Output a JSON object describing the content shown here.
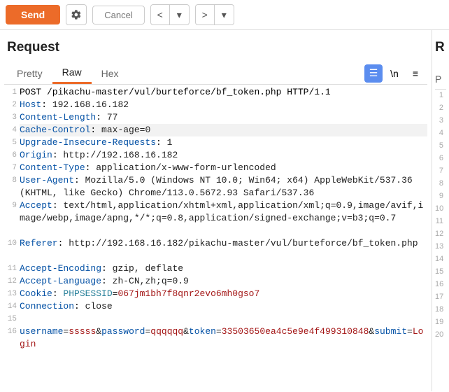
{
  "toolbar": {
    "send": "Send",
    "cancel": "Cancel"
  },
  "request": {
    "title": "Request",
    "tabs": {
      "pretty": "Pretty",
      "raw": "Raw",
      "hex": "Hex"
    },
    "symbols": {
      "newline": "\\n",
      "menu": "≡"
    },
    "raw": {
      "request_line": "POST /pikachu-master/vul/burteforce/bf_token.php HTTP/1.1",
      "headers": [
        {
          "k": "Host",
          "v": " 192.168.16.182"
        },
        {
          "k": "Content-Length",
          "v": " 77"
        },
        {
          "k": "Cache-Control",
          "v": " max-age=0"
        },
        {
          "k": "Upgrade-Insecure-Requests",
          "v": " 1"
        },
        {
          "k": "Origin",
          "v": " http://192.168.16.182"
        },
        {
          "k": "Content-Type",
          "v": " application/x-www-form-urlencoded"
        },
        {
          "k": "User-Agent",
          "v": " Mozilla/5.0 (Windows NT 10.0; Win64; x64) AppleWebKit/537.36 (KHTML, like Gecko) Chrome/113.0.5672.93 Safari/537.36"
        },
        {
          "k": "Accept",
          "v": " text/html,application/xhtml+xml,application/xml;q=0.9,image/avif,image/webp,image/apng,*/*;q=0.8,application/signed-exchange;v=b3;q=0.7"
        },
        {
          "k": "Referer",
          "v": " http://192.168.16.182/pikachu-master/vul/burteforce/bf_token.php"
        },
        {
          "k": "Accept-Encoding",
          "v": " gzip, deflate"
        },
        {
          "k": "Accept-Language",
          "v": " zh-CN,zh;q=0.9"
        }
      ],
      "cookie": {
        "k": "Cookie",
        "name": "PHPSESSID",
        "value": "067jm1bh7f8qnr2evo6mh0gso7"
      },
      "connection": {
        "k": "Connection",
        "v": " close"
      },
      "body": {
        "pairs": [
          {
            "k": "username",
            "v": "sssss"
          },
          {
            "k": "password",
            "v": "qqqqqq"
          },
          {
            "k": "token",
            "v": "33503650ea4c5e9e4f499310848"
          },
          {
            "k": "submit",
            "v": "Login"
          }
        ]
      }
    }
  },
  "response": {
    "title_initial": "R",
    "tab_initial": "P",
    "gutter": [
      "1",
      "2",
      "3",
      "4",
      "5",
      "6",
      "7",
      "8",
      "9",
      "10",
      "11",
      "12",
      "13",
      "14",
      "15",
      "16",
      "17",
      "18",
      "19",
      "20"
    ]
  }
}
